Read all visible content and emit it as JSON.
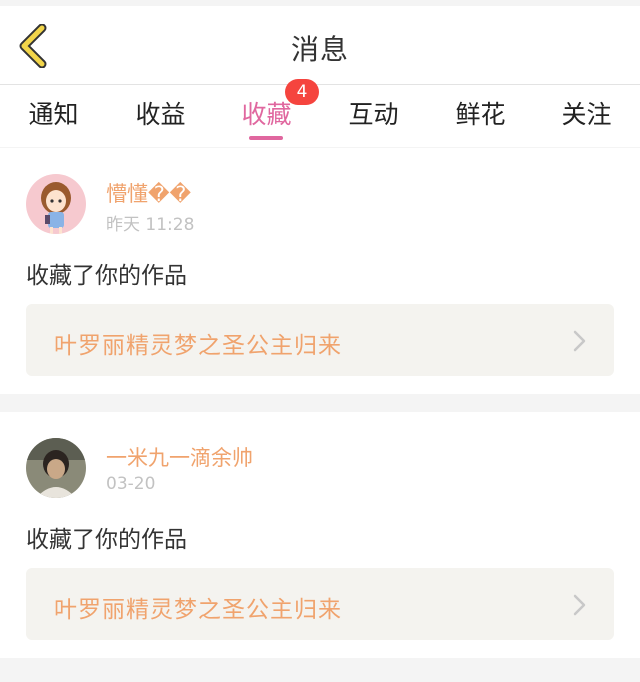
{
  "header": {
    "title": "消息"
  },
  "tabs": [
    {
      "label": "通知"
    },
    {
      "label": "收益"
    },
    {
      "label": "收藏",
      "badge": "4",
      "active": true
    },
    {
      "label": "互动"
    },
    {
      "label": "鲜花"
    },
    {
      "label": "关注"
    }
  ],
  "messages": [
    {
      "username": "懵懂��",
      "time": "昨天 11:28",
      "action": "收藏了你的作品",
      "work_title": "叶罗丽精灵梦之圣公主归来"
    },
    {
      "username": "一米九一滴余帅",
      "time": "03-20",
      "action": "收藏了你的作品",
      "work_title": "叶罗丽精灵梦之圣公主归来"
    }
  ],
  "colors": {
    "accent": "#e0679f",
    "badge": "#f5443e",
    "username": "#f0a36d",
    "back_icon": "#f2d54a"
  },
  "icons": {
    "back": "back-chevron-icon",
    "arrow": "chevron-right-icon"
  }
}
